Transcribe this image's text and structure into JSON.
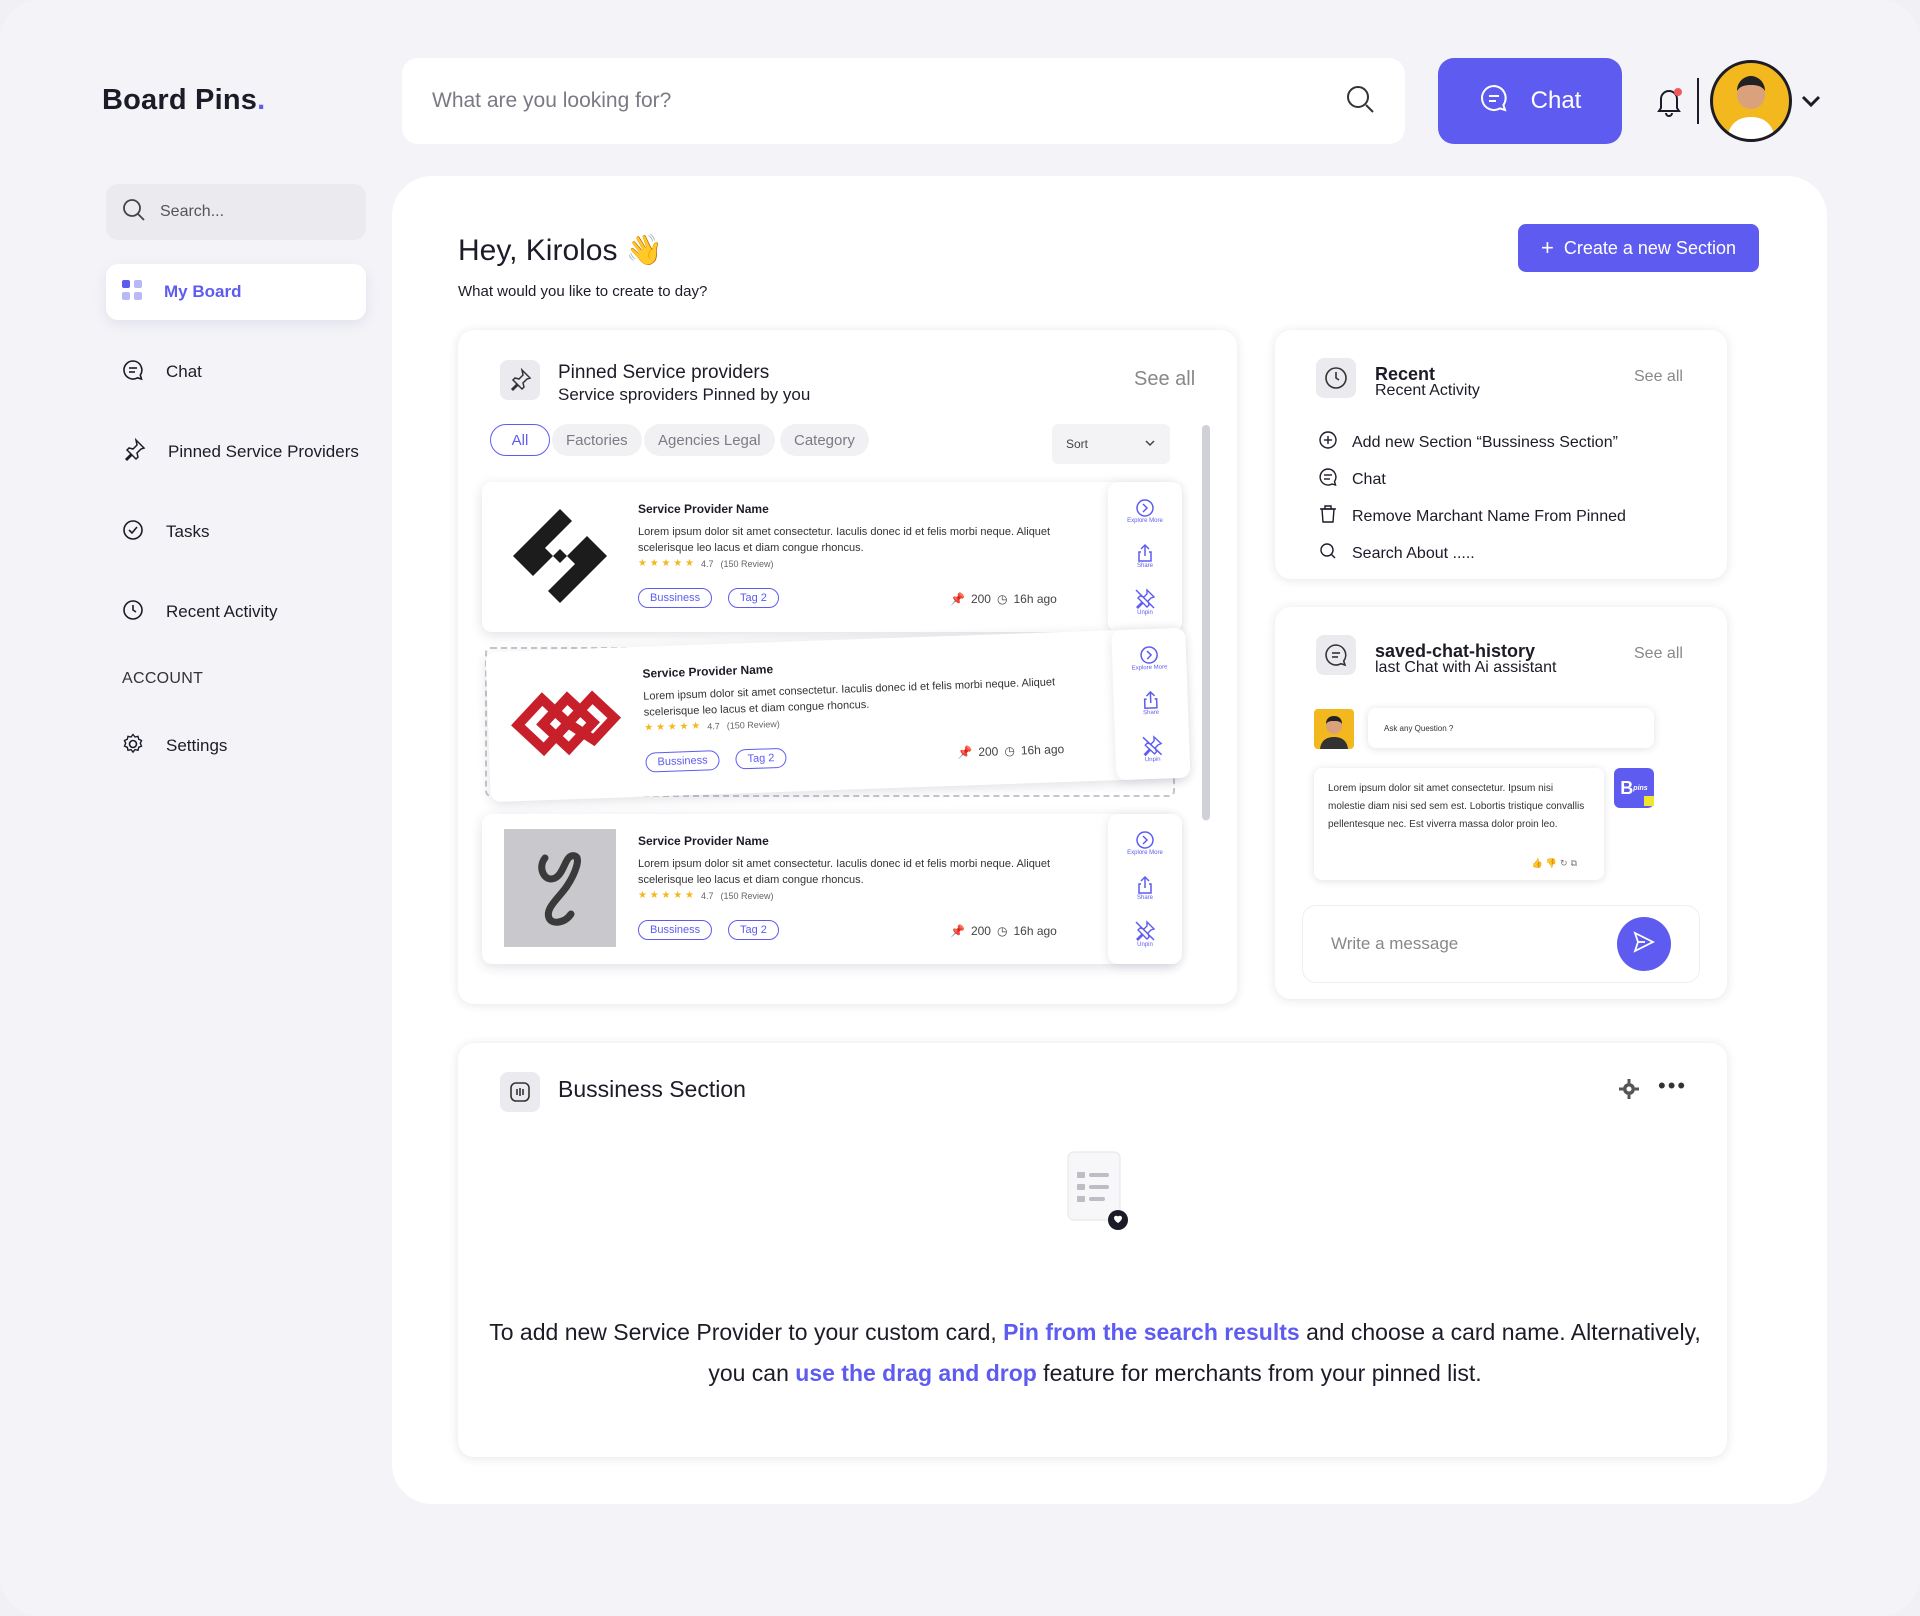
{
  "brand": {
    "name": "Board Pins",
    "dot": "."
  },
  "header": {
    "search_placeholder": "What are you looking for?",
    "chat_label": "Chat"
  },
  "sidebar": {
    "search_placeholder": "Search...",
    "items": [
      {
        "label": "My Board",
        "icon": "grid-icon"
      },
      {
        "label": "Chat",
        "icon": "chat-icon"
      },
      {
        "label": "Pinned Service Providers",
        "icon": "pin-icon"
      },
      {
        "label": "Tasks",
        "icon": "check-circle-icon"
      },
      {
        "label": "Recent Activity",
        "icon": "clock-icon"
      }
    ],
    "account_heading": "ACCOUNT",
    "settings_label": "Settings"
  },
  "main": {
    "greeting": "Hey, Kirolos",
    "greeting_emoji": "👋",
    "subtitle": "What would you like to create to day?",
    "create_section_label": "Create a new Section"
  },
  "pinned": {
    "title": "Pinned Service providers",
    "subtitle": "Service sproviders Pinned by you",
    "see_all": "See all",
    "filters": [
      "All",
      "Factories",
      "Agencies Legal",
      "Category"
    ],
    "sort_label": "Sort",
    "providers": [
      {
        "name": "Service Provider Name",
        "desc": "Lorem ipsum dolor sit amet consectetur. Iaculis donec id et felis morbi neque. Aliquet scelerisque leo lacus et diam congue rhoncus.",
        "rating": "4.7",
        "reviews": "(150 Review)",
        "tags": [
          "Bussiness",
          "Tag 2"
        ],
        "pins": "200",
        "time": "16h ago",
        "actions": [
          "Explore More",
          "Share",
          "Unpin"
        ]
      },
      {
        "name": "Service Provider Name",
        "desc": "Lorem ipsum dolor sit amet consectetur. Iaculis donec id et felis morbi neque. Aliquet scelerisque leo lacus et diam congue rhoncus.",
        "rating": "4.7",
        "reviews": "(150 Review)",
        "tags": [
          "Bussiness",
          "Tag 2"
        ],
        "pins": "200",
        "time": "16h ago",
        "actions": [
          "Explore More",
          "Share",
          "Unpin"
        ]
      },
      {
        "name": "Service Provider Name",
        "desc": "Lorem ipsum dolor sit amet consectetur. Iaculis donec id et felis morbi neque. Aliquet scelerisque leo lacus et diam congue rhoncus.",
        "rating": "4.7",
        "reviews": "(150 Review)",
        "tags": [
          "Bussiness",
          "Tag 2"
        ],
        "pins": "200",
        "time": "16h ago",
        "actions": [
          "Explore More",
          "Share",
          "Unpin"
        ]
      }
    ]
  },
  "recent": {
    "title": "Recent",
    "subtitle": "Recent Activity",
    "see_all": "See all",
    "items": [
      {
        "label": "Add new Section “Bussiness Section”",
        "icon": "plus-circle-icon"
      },
      {
        "label": "Chat",
        "icon": "chat-icon"
      },
      {
        "label": "Remove Marchant Name From Pinned",
        "icon": "trash-icon"
      },
      {
        "label": "Search About .....",
        "icon": "search-icon"
      }
    ]
  },
  "chat_history": {
    "title": "saved-chat-history",
    "subtitle": "last Chat with Ai assistant",
    "see_all": "See all",
    "question": "Ask any Question ?",
    "answer": "Lorem ipsum dolor sit amet consectetur. Ipsum nisi molestie diam nisi sed sem est. Lobortis tristique convallis pellentesque nec. Est viverra massa dolor proin leo.",
    "bot_logo_letter": "B",
    "bot_logo_small": "pins",
    "input_placeholder": "Write a message"
  },
  "business": {
    "title": "Bussiness Section",
    "info_a": "To add new Service Provider to your custom card, ",
    "info_link1": "Pin from the search results",
    "info_b": " and choose a card name. Alternatively, you can ",
    "info_link2": "use the drag and drop",
    "info_c": " feature for merchants from your pinned list."
  },
  "colors": {
    "accent": "#5e5cf0",
    "star": "#f3b81e",
    "avatar_bg": "#f3b81e",
    "notification_dot": "#f05a5a"
  }
}
